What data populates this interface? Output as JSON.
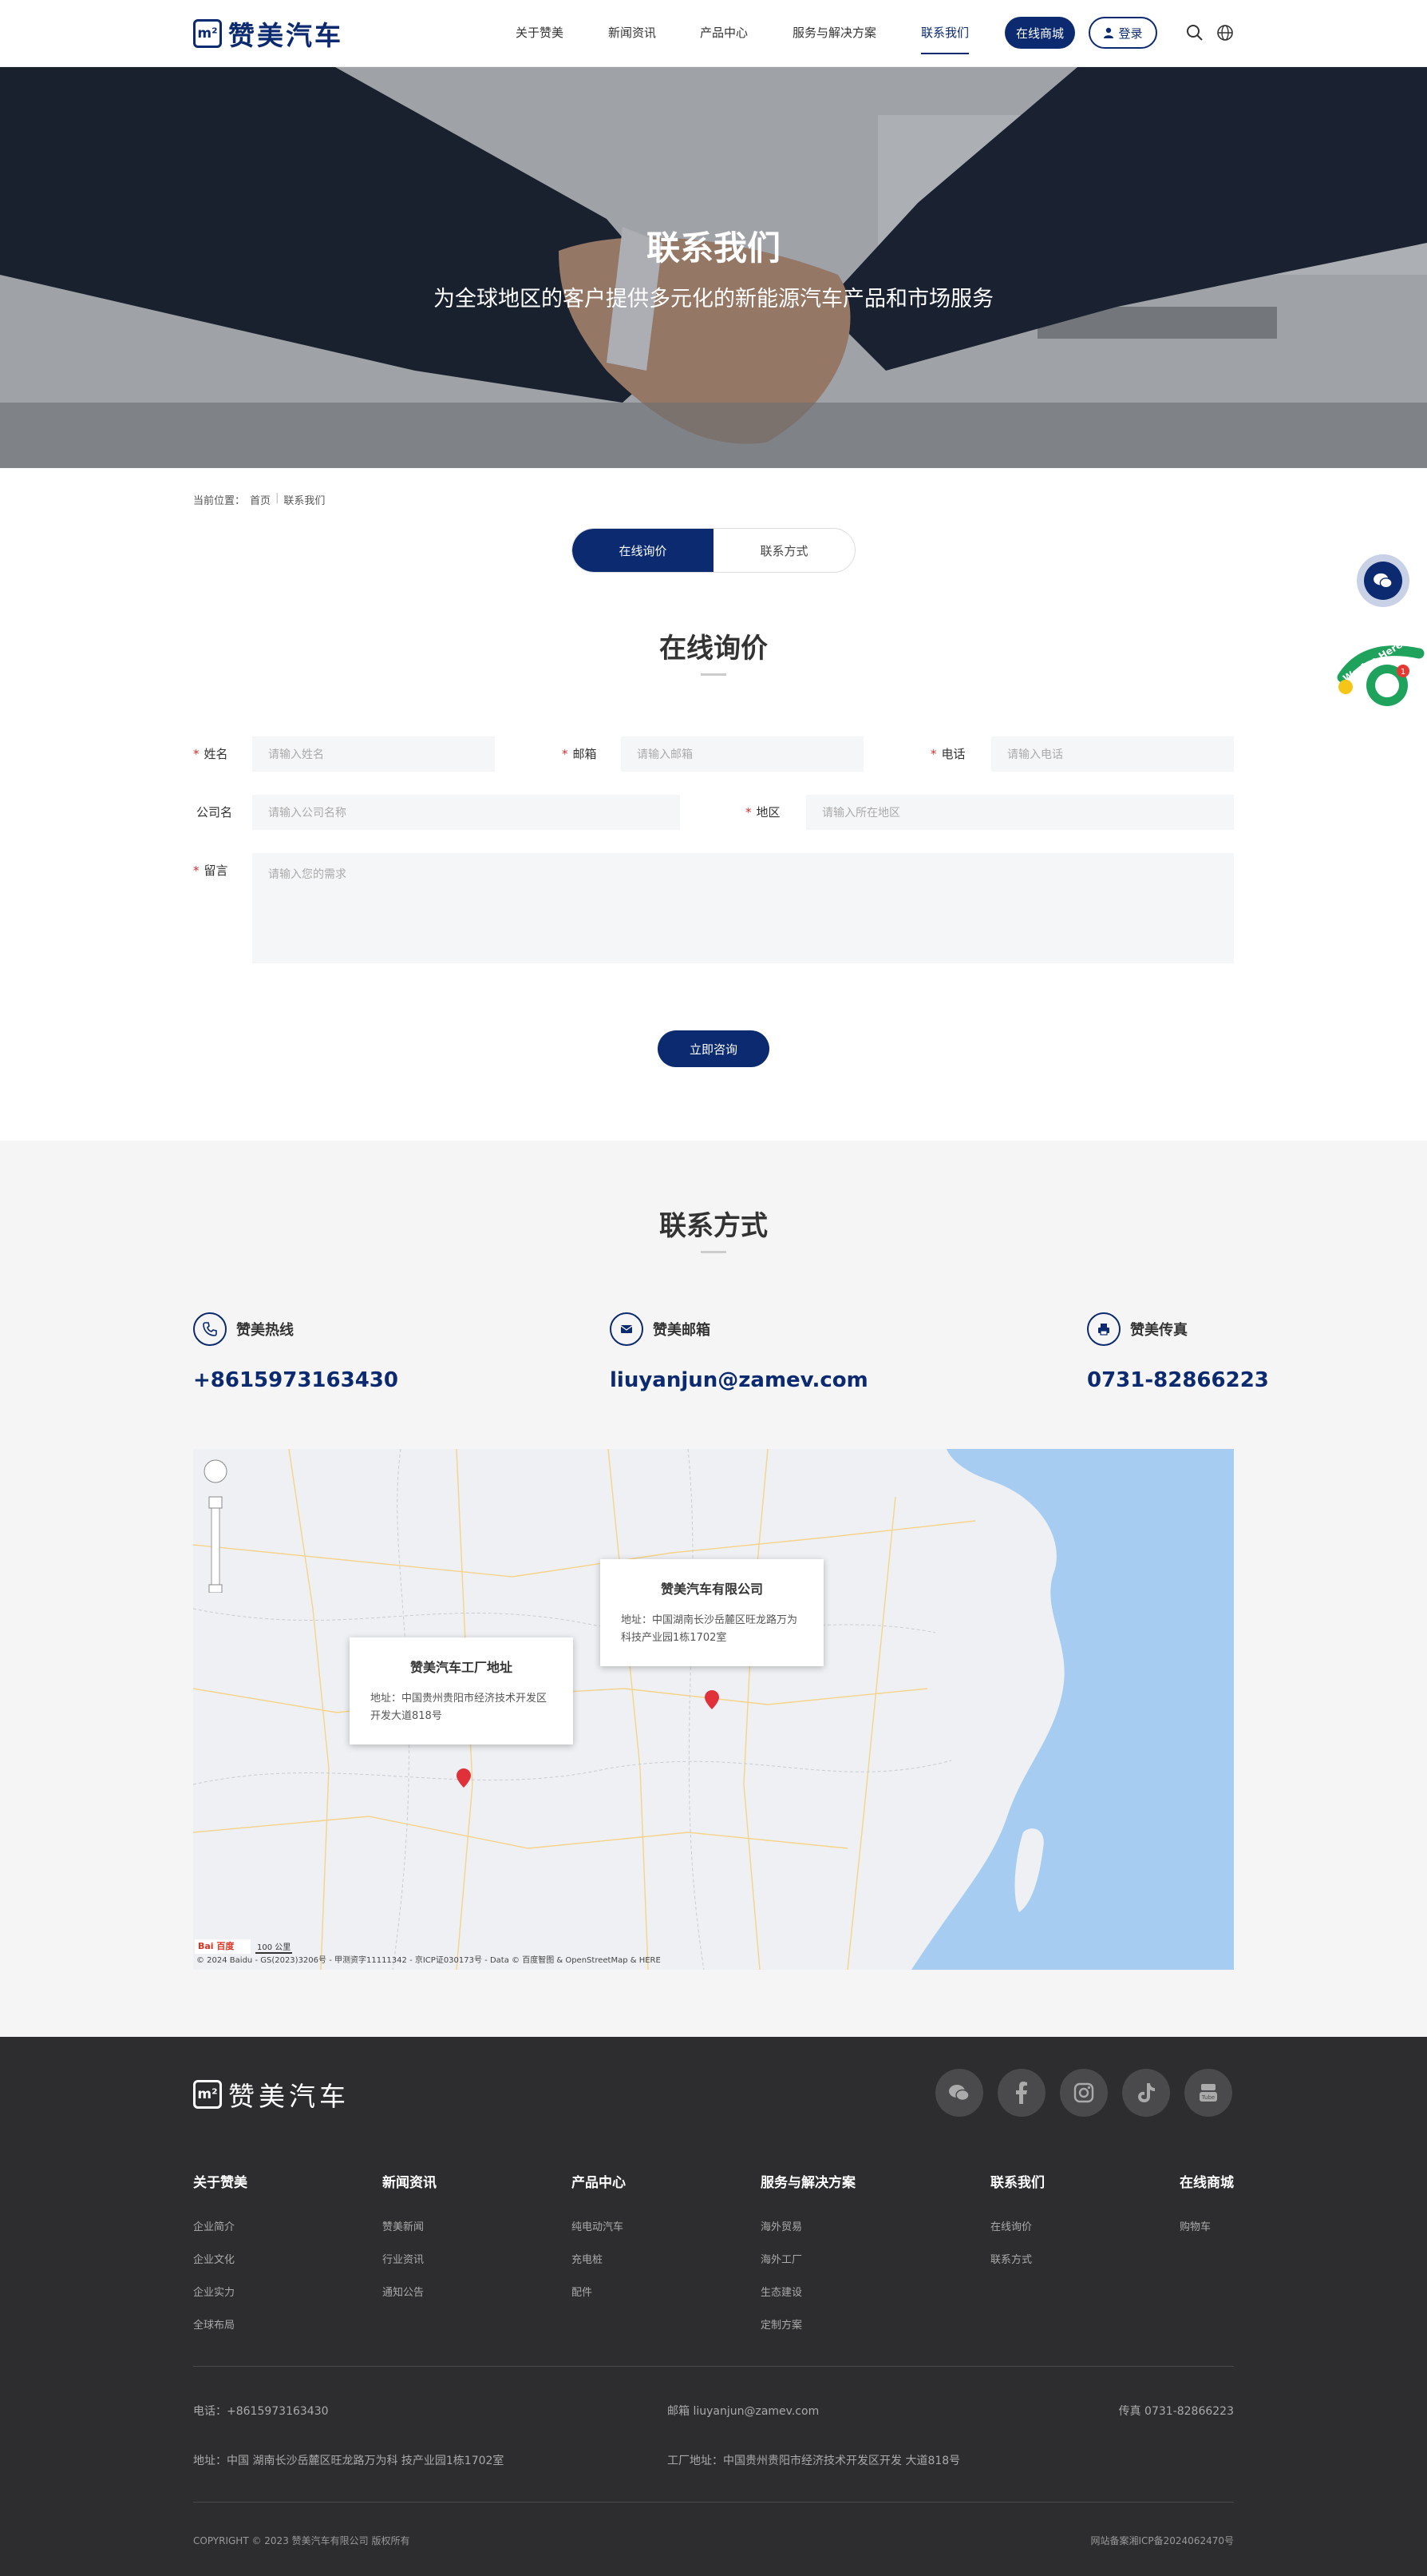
{
  "header": {
    "logo_text": "赞美汽车",
    "nav": [
      "关于赞美",
      "新闻资讯",
      "产品中心",
      "服务与解决方案",
      "联系我们"
    ],
    "shop_button": "在线商城",
    "login_button": "登录"
  },
  "hero": {
    "title": "联系我们",
    "subtitle": "为全球地区的客户提供多元化的新能源汽车产品和市场服务"
  },
  "breadcrumb": {
    "prefix": "当前位置：",
    "home": "首页",
    "current": "联系我们"
  },
  "tabs": [
    "在线询价",
    "联系方式"
  ],
  "inquiry": {
    "title": "在线询价",
    "fields": {
      "name_label": "姓名",
      "name_placeholder": "请输入姓名",
      "email_label": "邮箱",
      "email_placeholder": "请输入邮箱",
      "phone_label": "电话",
      "phone_placeholder": "请输入电话",
      "company_label": "公司名",
      "company_placeholder": "请输入公司名称",
      "region_label": "地区",
      "region_placeholder": "请输入所在地区",
      "message_label": "留言",
      "message_placeholder": "请输入您的需求"
    },
    "submit": "立即咨询"
  },
  "contact": {
    "title": "联系方式",
    "hotline_label": "赞美热线",
    "hotline": "+8615973163430",
    "email_label": "赞美邮箱",
    "email": "liuyanjun@zamev.com",
    "fax_label": "赞美传真",
    "fax": "0731-82866223"
  },
  "map": {
    "hq_title": "赞美汽车有限公司",
    "hq_address": "地址：中国湖南长沙岳麓区旺龙路万为科技产业园1栋1702室",
    "factory_title": "赞美汽车工厂地址",
    "factory_address": "地址：中国贵州贵阳市经济技术开发区开发大道818号",
    "scale": "100 公里",
    "copyright": "© 2024 Baidu - GS(2023)3206号 - 甲测资字11111342 - 京ICP证030173号 - Data © 百度智图 & OpenStreetMap & HERE"
  },
  "footer": {
    "logo_text": "赞美汽车",
    "social": [
      "wechat-icon",
      "facebook-icon",
      "instagram-icon",
      "tiktok-icon",
      "youtube-icon"
    ],
    "columns": [
      {
        "title": "关于赞美",
        "links": [
          "企业简介",
          "企业文化",
          "企业实力",
          "全球布局"
        ]
      },
      {
        "title": "新闻资讯",
        "links": [
          "赞美新闻",
          "行业资讯",
          "通知公告"
        ]
      },
      {
        "title": "产品中心",
        "links": [
          "纯电动汽车",
          "充电桩",
          "配件"
        ]
      },
      {
        "title": "服务与解决方案",
        "links": [
          "海外贸易",
          "海外工厂",
          "生态建设",
          "定制方案"
        ]
      },
      {
        "title": "联系我们",
        "links": [
          "在线询价",
          "联系方式"
        ]
      },
      {
        "title": "在线商城",
        "links": [
          "购物车"
        ]
      }
    ],
    "phone": "电话：+8615973163430",
    "email": "邮箱 liuyanjun@zamev.com",
    "fax": "传真 0731-82866223",
    "address": "地址：中国 湖南长沙岳麓区旺龙路万为科 技产业园1栋1702室",
    "factory": "工厂地址：中国贵州贵阳市经济技术开发区开发 大道818号",
    "copyright": "COPYRIGHT © 2023 赞美汽车有限公司 版权所有",
    "icp": "网站备案湘ICP备2024062470号"
  },
  "colors": {
    "brand": "#0b2a6f",
    "footer_bg": "#2d2d2f",
    "section_bg": "#f5f5f5"
  }
}
